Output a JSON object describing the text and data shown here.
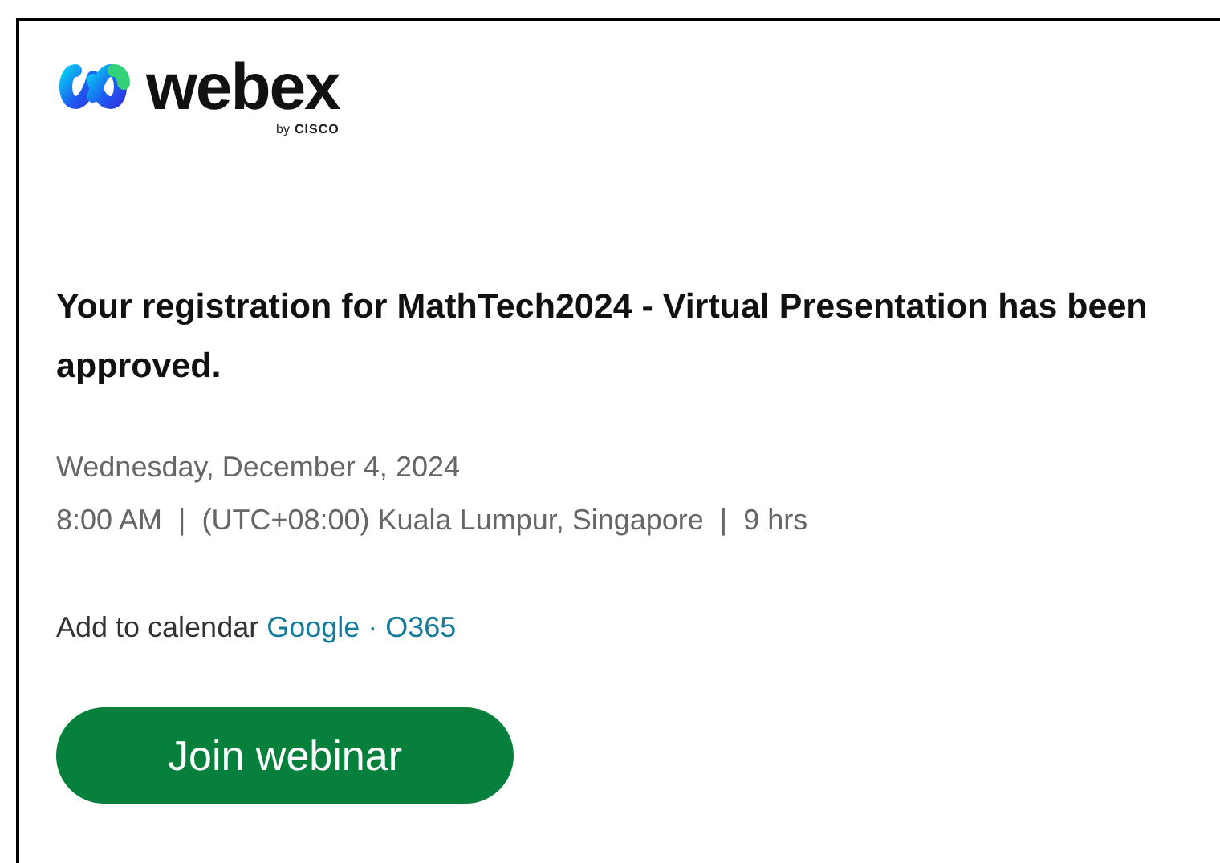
{
  "logo": {
    "wordmark": "webex",
    "byline_prefix": "by",
    "byline_brand": "CISCO"
  },
  "heading": "Your registration for MathTech2024 - Virtual Presentation has been approved.",
  "date": "Wednesday, December 4, 2024",
  "time_line": {
    "time": "8:00 AM",
    "timezone": "(UTC+08:00) Kuala Lumpur, Singapore",
    "duration": "9 hrs",
    "separator": "|"
  },
  "calendar": {
    "label": "Add to calendar",
    "links": [
      "Google",
      "O365"
    ],
    "separator": "·"
  },
  "button": {
    "label": "Join webinar"
  }
}
